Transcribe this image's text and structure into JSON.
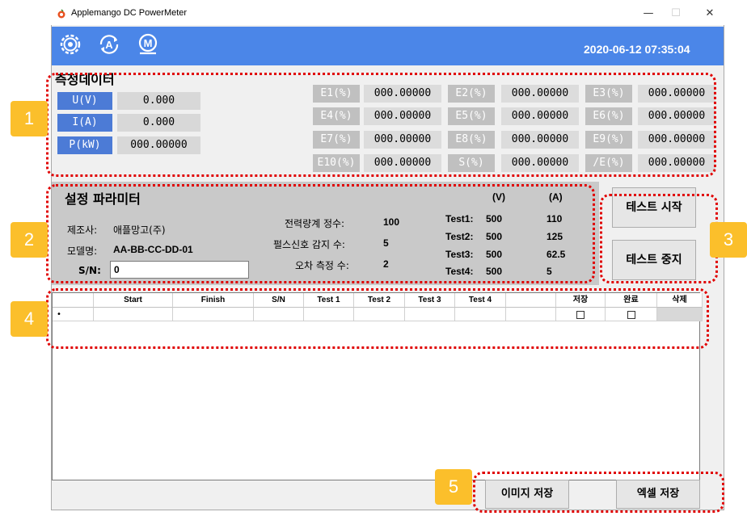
{
  "window": {
    "title": "Applemango DC PowerMeter",
    "minimize_glyph": "—",
    "maximize_glyph": "☐",
    "close_glyph": "✕"
  },
  "toolbar": {
    "icons": [
      "gear-icon",
      "auto-a-icon",
      "manual-m-icon"
    ],
    "datetime": "2020-06-12 07:35:04",
    "bg_color": "#4b86e8"
  },
  "measure": {
    "title": "측정데이터",
    "rows": [
      {
        "label": "U(V)",
        "value": "0.000"
      },
      {
        "label": "I(A)",
        "value": "0.000"
      },
      {
        "label": "P(kW)",
        "value": "000.00000"
      }
    ],
    "errors": [
      {
        "label": "E1(%)",
        "value": "000.00000"
      },
      {
        "label": "E2(%)",
        "value": "000.00000"
      },
      {
        "label": "E3(%)",
        "value": "000.00000"
      },
      {
        "label": "E4(%)",
        "value": "000.00000"
      },
      {
        "label": "E5(%)",
        "value": "000.00000"
      },
      {
        "label": "E6(%)",
        "value": "000.00000"
      },
      {
        "label": "E7(%)",
        "value": "000.00000"
      },
      {
        "label": "E8(%)",
        "value": "000.00000"
      },
      {
        "label": "E9(%)",
        "value": "000.00000"
      },
      {
        "label": "E10(%)",
        "value": "000.00000"
      },
      {
        "label": "S(%)",
        "value": "000.00000"
      },
      {
        "label": "/E(%)",
        "value": "000.00000"
      }
    ]
  },
  "setup": {
    "title": "설정 파라미터",
    "maker_label": "제조사:",
    "maker_value": "애플망고(주)",
    "model_label": "모델명:",
    "model_value": "AA-BB-CC-DD-01",
    "sn_label": "S/N:",
    "sn_value": "0",
    "constant_label": "전력량계 정수:",
    "constant_value": "100",
    "pulse_label": "펄스신호 감지 수:",
    "pulse_value": "5",
    "error_count_label": "오차 측정 수:",
    "error_count_value": "2",
    "v_header": "(V)",
    "a_header": "(A)",
    "tests": [
      {
        "name": "Test1:",
        "v": "500",
        "a": "110"
      },
      {
        "name": "Test2:",
        "v": "500",
        "a": "125"
      },
      {
        "name": "Test3:",
        "v": "500",
        "a": "62.5"
      },
      {
        "name": "Test4:",
        "v": "500",
        "a": "5"
      }
    ]
  },
  "buttons": {
    "start": "테스트 시작",
    "stop": "테스트 중지",
    "save_image": "이미지 저장",
    "save_excel": "엑셀 저장"
  },
  "grid": {
    "columns": [
      "Start",
      "Finish",
      "S/N",
      "Test 1",
      "Test 2",
      "Test 3",
      "Test 4",
      "",
      "저장",
      "완료",
      "삭제"
    ],
    "row_marker": "•"
  },
  "badges": [
    "1",
    "2",
    "3",
    "4",
    "5"
  ],
  "highlight_color": "#e00000",
  "badge_color": "#fbbf2b"
}
